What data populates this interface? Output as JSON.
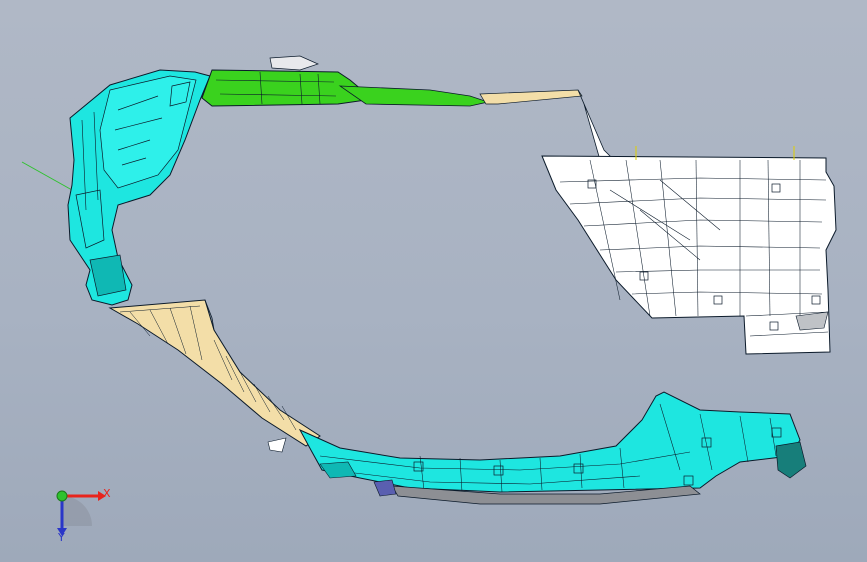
{
  "viewport": {
    "background_top": "#b0b8c6",
    "background_bottom": "#9ea9ba"
  },
  "colors": {
    "cyan_part": "#1ee6e0",
    "green_part": "#3ad21e",
    "white_part": "#ffffff",
    "cream_part": "#f3dea8",
    "gray_trim": "#8d8f94",
    "edge": "#0b1a2a"
  },
  "triad": {
    "x_label": "X",
    "y_label": "Y",
    "x_color": "#e8241c",
    "y_color": "#2a36c8",
    "z_color": "#2ec22e"
  },
  "parts": [
    {
      "name": "upper-left-pillar-trim",
      "color": "cyan"
    },
    {
      "name": "roof-rail-trim",
      "color": "green"
    },
    {
      "name": "rear-quarter-panel",
      "color": "white"
    },
    {
      "name": "a-pillar-lower-trim",
      "color": "cream"
    },
    {
      "name": "sill-and-rear-arch-trim",
      "color": "cyan"
    }
  ]
}
